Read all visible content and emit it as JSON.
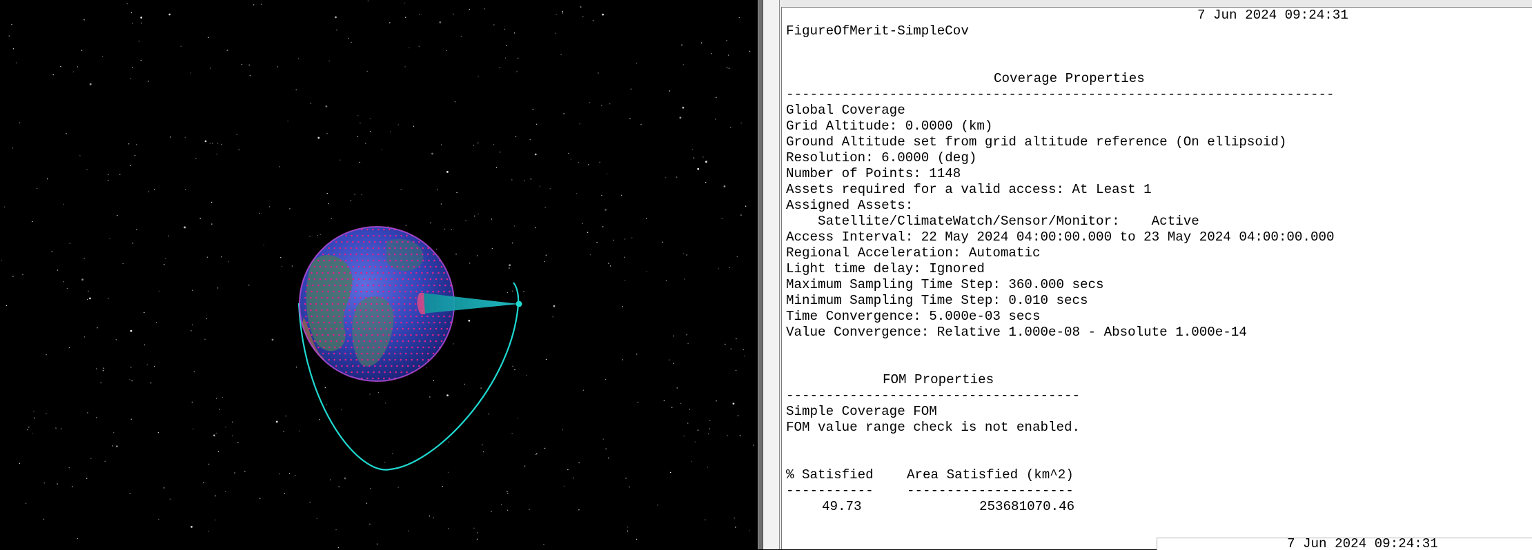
{
  "report": {
    "timestamp": "7 Jun 2024 09:24:31",
    "object_path": "FigureOfMerit-SimpleCov",
    "coverage_heading": "Coverage Properties",
    "coverage_rule": "---------------------------------------------------------------------",
    "coverage_lines": [
      "Global Coverage",
      "Grid Altitude: 0.0000 (km)",
      "Ground Altitude set from grid altitude reference (On ellipsoid)",
      "Resolution: 6.0000 (deg)",
      "Number of Points: 1148",
      "Assets required for a valid access: At Least 1",
      "Assigned Assets:",
      "    Satellite/ClimateWatch/Sensor/Monitor:    Active",
      "Access Interval: 22 May 2024 04:00:00.000 to 23 May 2024 04:00:00.000",
      "Regional Acceleration: Automatic",
      "Light time delay: Ignored",
      "Maximum Sampling Time Step: 360.000 secs",
      "Minimum Sampling Time Step: 0.010 secs",
      "Time Convergence: 5.000e-03 secs",
      "Value Convergence: Relative 1.000e-08 - Absolute 1.000e-14"
    ],
    "fom_heading": "FOM Properties",
    "fom_rule": "-------------------------------------",
    "fom_lines": [
      "Simple Coverage FOM",
      "FOM value range check is not enabled."
    ],
    "results_table": {
      "columns": [
        "% Satisfied",
        "Area Satisfied (km^2)"
      ],
      "col_rules": [
        "-----------",
        "---------------------"
      ],
      "rows": [
        [
          "49.73",
          "253681070.46"
        ]
      ]
    }
  },
  "second_report": {
    "timestamp": "7 Jun 2024 09:24:31"
  },
  "viewer": {
    "scene": "3D globe view with coverage grid points, satellite orbit and sensor cone",
    "colors": {
      "orbit": "#1fd8d0",
      "sensor_cone": "#18a6b0",
      "grid_points": "#e0208c",
      "globe_base": "#2e3fa8",
      "space": "#000000"
    }
  },
  "colors": {
    "report_background": "#ffffff",
    "report_text": "#000000",
    "splitter": "#6f6f6f"
  }
}
